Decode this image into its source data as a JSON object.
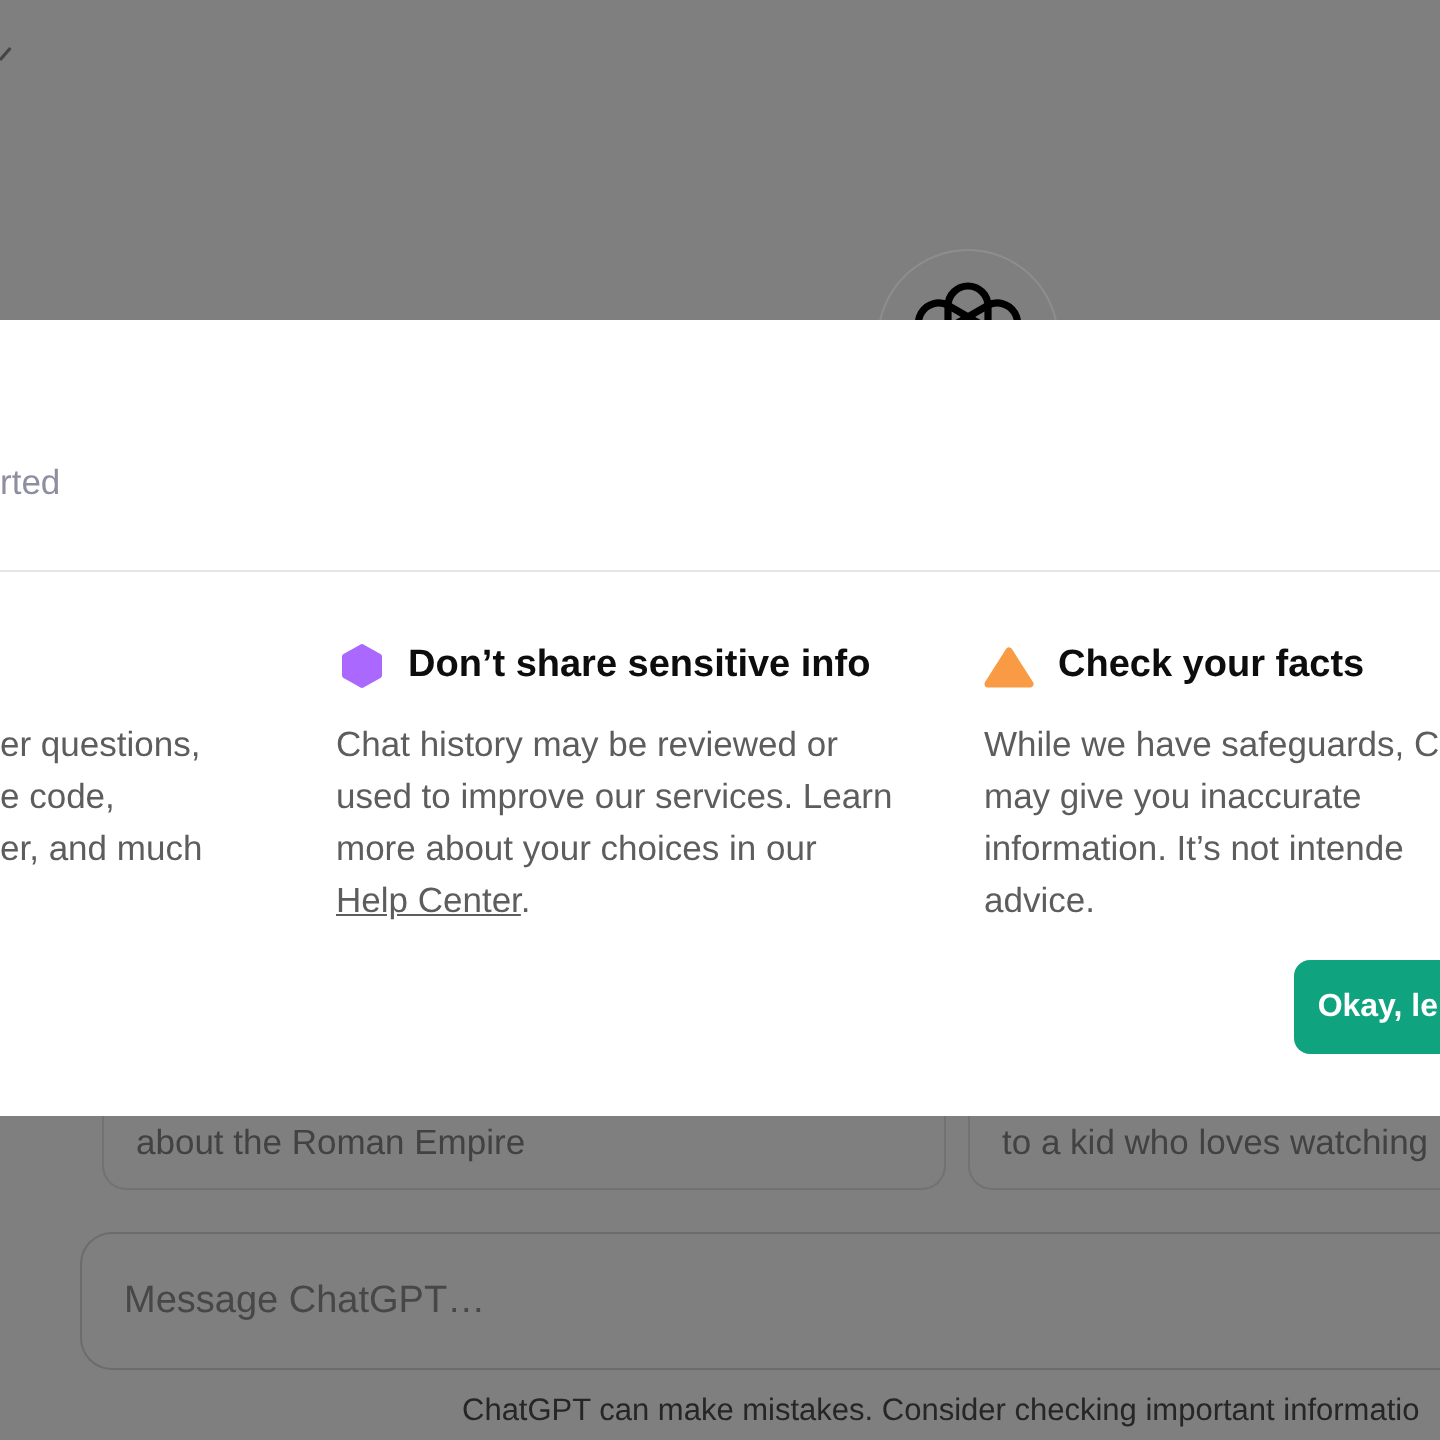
{
  "modal": {
    "heading": "rted",
    "columns": [
      {
        "lines": [
          "er questions,",
          "e code,",
          "er, and much"
        ]
      },
      {
        "kind": "hexagon",
        "color": "#ab68ff",
        "title": "Don’t share sensitive info",
        "lines": [
          "Chat history may be reviewed or",
          "used to improve our services. Learn",
          "more about your choices in our"
        ],
        "link": "Help Center",
        "after_link": "."
      },
      {
        "kind": "triangle",
        "color": "#f99b45",
        "title": "Check your facts",
        "lines": [
          "While we have safeguards, C",
          "may give you inaccurate",
          "information. It’s not intende",
          "advice."
        ]
      }
    ],
    "button": "Okay, le"
  },
  "suggestions": [
    {
      "text": "about the Roman Empire"
    },
    {
      "text": "to a kid who loves watching"
    }
  ],
  "message_field": {
    "placeholder": "Message ChatGPT…"
  },
  "footer_note": "ChatGPT can make mistakes. Consider checking important informatio"
}
